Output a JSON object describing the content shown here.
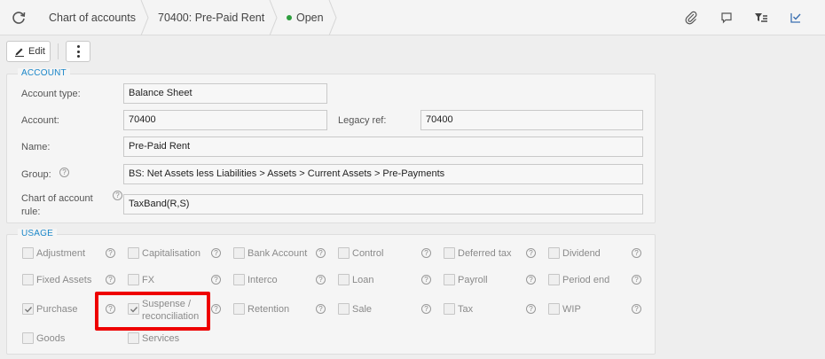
{
  "header": {
    "breadcrumb_root": "Chart of accounts",
    "breadcrumb_record": "70400: Pre-Paid Rent",
    "status_label": "Open",
    "status_color": "#2e9e3e",
    "icons": [
      "refresh-icon",
      "paperclip-icon",
      "comment-icon",
      "filter-list-icon",
      "checklist-icon"
    ]
  },
  "toolbar": {
    "edit_label": "Edit",
    "more_icon": "more-vertical-icon"
  },
  "account": {
    "section_title": "ACCOUNT",
    "account_type_label": "Account type:",
    "account_type_value": "Balance Sheet",
    "account_label": "Account:",
    "account_value": "70400",
    "legacy_ref_label": "Legacy ref:",
    "legacy_ref_value": "70400",
    "name_label": "Name:",
    "name_value": "Pre-Paid Rent",
    "group_label": "Group:",
    "group_value": "BS: Net Assets less Liabilities > Assets > Current Assets > Pre-Payments",
    "rule_label": "Chart of account rule:",
    "rule_value": "TaxBand(R,S)"
  },
  "usage": {
    "section_title": "USAGE",
    "items": [
      {
        "label": "Adjustment",
        "checked": false
      },
      {
        "label": "Capitalisation",
        "checked": false
      },
      {
        "label": "Bank Account",
        "checked": false
      },
      {
        "label": "Control",
        "checked": false
      },
      {
        "label": "Deferred tax",
        "checked": false
      },
      {
        "label": "Dividend",
        "checked": false
      },
      {
        "label": "Fixed Assets",
        "checked": false
      },
      {
        "label": "FX",
        "checked": false
      },
      {
        "label": "Interco",
        "checked": false
      },
      {
        "label": "Loan",
        "checked": false
      },
      {
        "label": "Payroll",
        "checked": false
      },
      {
        "label": "Period end",
        "checked": false
      },
      {
        "label": "Purchase",
        "checked": true
      },
      {
        "label": "Suspense / reconciliation",
        "checked": true
      },
      {
        "label": "Retention",
        "checked": false
      },
      {
        "label": "Sale",
        "checked": false
      },
      {
        "label": "Tax",
        "checked": false
      },
      {
        "label": "WIP",
        "checked": false
      },
      {
        "label": "Goods",
        "checked": false
      },
      {
        "label": "Services",
        "checked": false
      }
    ]
  },
  "annotation": {
    "highlight_color": "#ee0000"
  }
}
